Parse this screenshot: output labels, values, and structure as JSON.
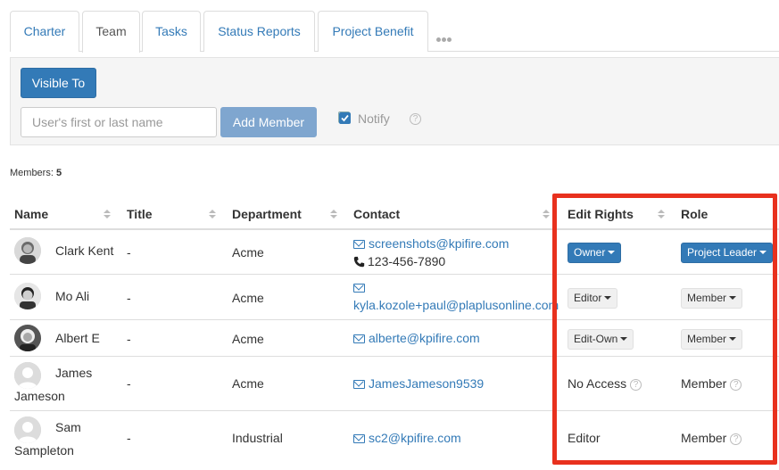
{
  "tabs": [
    {
      "label": "Charter"
    },
    {
      "label": "Team",
      "active": true
    },
    {
      "label": "Tasks"
    },
    {
      "label": "Status Reports"
    },
    {
      "label": "Project Benefit"
    }
  ],
  "panel": {
    "visible_to_label": "Visible To",
    "user_input_placeholder": "User's first or last name",
    "add_member_label": "Add Member",
    "notify_label": "Notify",
    "notify_checked": true
  },
  "members": {
    "label": "Members:",
    "count": "5"
  },
  "table": {
    "headers": {
      "name": "Name",
      "title": "Title",
      "department": "Department",
      "contact": "Contact",
      "edit_rights": "Edit Rights",
      "role": "Role"
    },
    "rows": [
      {
        "name": "Clark Kent",
        "title": "-",
        "department": "Acme",
        "email": "screenshots@kpifire.com",
        "phone": "123-456-7890",
        "edit_rights": "Owner",
        "role": "Project Leader"
      },
      {
        "name": "Mo Ali",
        "title": "-",
        "department": "Acme",
        "email": "kyla.kozole+paul@plaplusonline.com",
        "edit_rights": "Editor",
        "role": "Member"
      },
      {
        "name": "Albert E",
        "title": "-",
        "department": "Acme",
        "email": "alberte@kpifire.com",
        "edit_rights": "Edit-Own",
        "role": "Member"
      },
      {
        "name_line1": "James",
        "name_line2": "Jameson",
        "title": "-",
        "department": "Acme",
        "email": "JamesJameson9539",
        "edit_rights": "No Access",
        "role": "Member"
      },
      {
        "name_line1": "Sam",
        "name_line2": "Sampleton",
        "title": "-",
        "department": "Industrial",
        "email": "sc2@kpifire.com",
        "edit_rights": "Editor",
        "role": "Member"
      }
    ]
  },
  "colors": {
    "accent": "#337ab7",
    "highlight": "#e8311e"
  }
}
